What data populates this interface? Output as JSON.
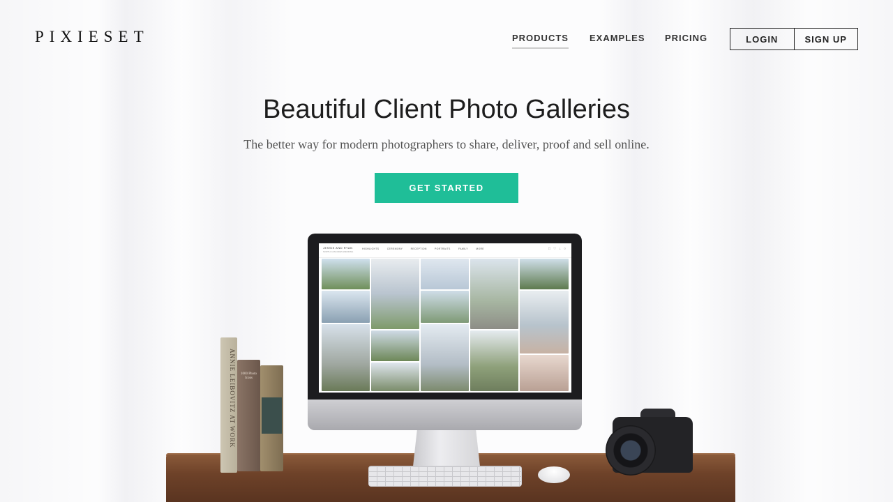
{
  "header": {
    "logo": "PIXIESET",
    "nav": [
      {
        "label": "PRODUCTS",
        "active": true
      },
      {
        "label": "EXAMPLES",
        "active": false
      },
      {
        "label": "PRICING",
        "active": false
      }
    ],
    "login_label": "LOGIN",
    "signup_label": "SIGN UP"
  },
  "hero": {
    "title": "Beautiful Client Photo Galleries",
    "subtitle": "The better way for modern photographers to share, deliver, proof and sell online.",
    "cta_label": "GET STARTED",
    "cta_color": "#1fbe98"
  },
  "gallery_preview": {
    "name": "JESSIE AND RYAN",
    "subtitle": "NORTH CASCADES WEDDING",
    "links": [
      "HIGHLIGHTS",
      "CEREMONY",
      "RECEPTION",
      "PORTRAITS",
      "FAMILY",
      "MORE"
    ],
    "icons": [
      "cart-icon",
      "heart-icon",
      "download-icon",
      "share-icon"
    ]
  },
  "books": {
    "book1_title": "ANNIE LEIBOVITZ AT WORK",
    "book2_title": "1000 Photo Icons"
  }
}
